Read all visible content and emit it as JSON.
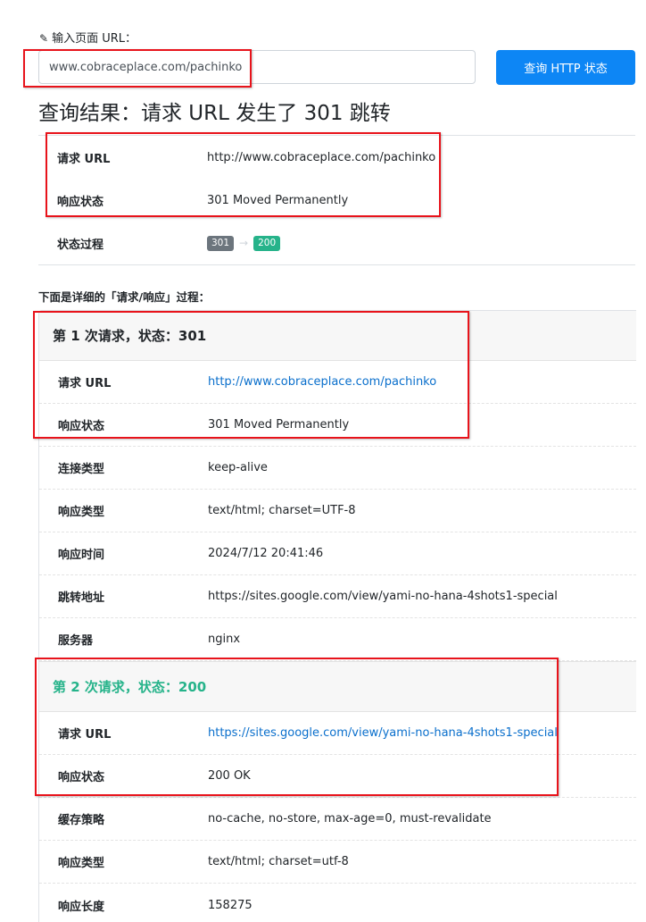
{
  "input_section": {
    "label": "输入页面 URL：",
    "url_value": "www.cobraceplace.com/pachinko",
    "submit_label": "查询 HTTP 状态"
  },
  "result": {
    "title": "查询结果：请求 URL 发生了 301 跳转",
    "rows": [
      {
        "key": "请求 URL",
        "value": "http://www.cobraceplace.com/pachinko"
      },
      {
        "key": "响应状态",
        "value": "301 Moved Permanently"
      }
    ],
    "process_label": "状态过程",
    "process_chain": [
      "301",
      "200"
    ]
  },
  "detail": {
    "heading": "下面是详细的「请求/响应」过程：",
    "requests": [
      {
        "header": "第 1 次请求，状态：301",
        "rows": [
          {
            "key": "请求 URL",
            "value": "http://www.cobraceplace.com/pachinko",
            "is_link": true
          },
          {
            "key": "响应状态",
            "value": "301 Moved Permanently"
          },
          {
            "key": "连接类型",
            "value": "keep-alive"
          },
          {
            "key": "响应类型",
            "value": "text/html; charset=UTF-8"
          },
          {
            "key": "响应时间",
            "value": "2024/7/12 20:41:46"
          },
          {
            "key": "跳转地址",
            "value": "https://sites.google.com/view/yami-no-hana-4shots1-special"
          },
          {
            "key": "服务器",
            "value": "nginx"
          }
        ]
      },
      {
        "header": "第 2 次请求，状态：200",
        "rows": [
          {
            "key": "请求 URL",
            "value": "https://sites.google.com/view/yami-no-hana-4shots1-special",
            "is_link": true
          },
          {
            "key": "响应状态",
            "value": "200 OK"
          },
          {
            "key": "缓存策略",
            "value": "no-cache, no-store, max-age=0, must-revalidate"
          },
          {
            "key": "响应类型",
            "value": "text/html; charset=utf-8"
          },
          {
            "key": "响应长度",
            "value": "158275"
          }
        ]
      }
    ]
  },
  "colors": {
    "primary_button": "#0d86f5",
    "success_green": "#26b38a",
    "redirect_gray": "#6c757d",
    "link_blue": "#0a6fcc",
    "annotation_red": "#e8131b"
  },
  "icons": {
    "input_label_icon": "pencil-icon",
    "process_arrow": "arrow-right-icon"
  }
}
